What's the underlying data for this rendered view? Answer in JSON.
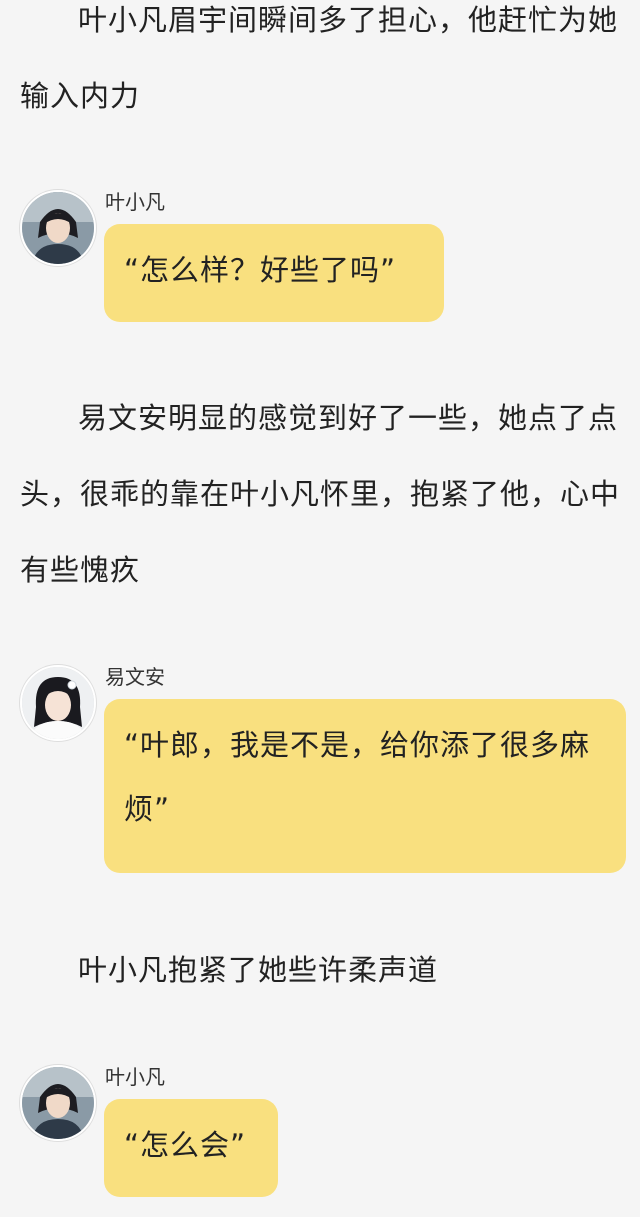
{
  "story": {
    "para_1": "叶小凡眉宇间瞬间多了担心，他赶忙为她输入内力",
    "para_2": "易文安明显的感觉到好了一些，她点了点头，很乖的靠在叶小凡怀里，抱紧了他，心中有些愧疚",
    "para_3": "叶小凡抱紧了她些许柔声道"
  },
  "messages": [
    {
      "speaker": "叶小凡",
      "text": "“怎么样？好些了吗”",
      "avatar": "male-avatar"
    },
    {
      "speaker": "易文安",
      "text": "“叶郎，我是不是，给你添了很多麻烦”",
      "avatar": "female-avatar"
    },
    {
      "speaker": "叶小凡",
      "text": "“怎么会”",
      "avatar": "male-avatar"
    }
  ],
  "colors": {
    "background": "#f5f5f5",
    "bubble": "#f9e07f",
    "text": "#222222"
  }
}
